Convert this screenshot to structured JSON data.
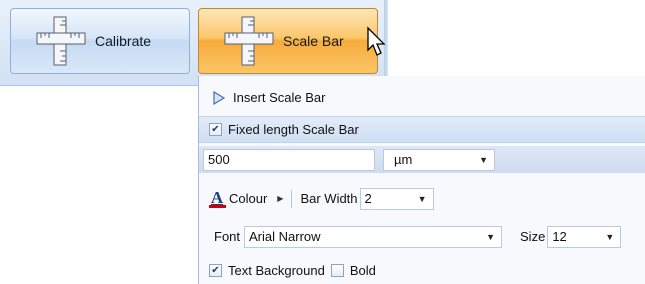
{
  "ribbon": {
    "calibrate_label": "Calibrate",
    "scalebar_label": "Scale Bar"
  },
  "menu": {
    "insert_label": "Insert Scale Bar",
    "fixed_length": {
      "label": "Fixed length Scale Bar",
      "checked": true
    },
    "length_value": "500",
    "unit_value": "µm",
    "colour_label": "Colour",
    "colour_swatch": "#d40000",
    "bar_width_label": "Bar Width",
    "bar_width_value": "2",
    "font_label": "Font",
    "font_value": "Arial Narrow",
    "size_label": "Size",
    "size_value": "12",
    "text_background": {
      "label": "Text Background",
      "checked": true
    },
    "bold": {
      "label": "Bold",
      "checked": false
    }
  }
}
